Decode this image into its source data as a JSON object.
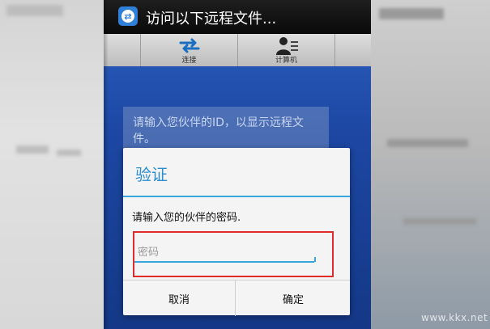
{
  "app": {
    "title": "访问以下远程文件...",
    "icon": "teamviewer-icon"
  },
  "tabs": [
    {
      "label": "连接",
      "icon": "connect-arrows-icon"
    },
    {
      "label": "计算机",
      "icon": "computer-contacts-icon"
    }
  ],
  "hint": {
    "text": "请输入您伙伴的ID，以显示远程文件。"
  },
  "dialog": {
    "title": "验证",
    "message": "请输入您的伙伴的密码.",
    "password_placeholder": "密码",
    "password_value": "",
    "cancel_label": "取消",
    "ok_label": "确定"
  },
  "watermark": "www.kkx.net",
  "colors": {
    "accent": "#3aa5dd",
    "title_text": "#2c8ed1",
    "highlight_box": "#e02b2b",
    "screen_bg": "#1d47a3",
    "titlebar_bg": "#111111"
  }
}
